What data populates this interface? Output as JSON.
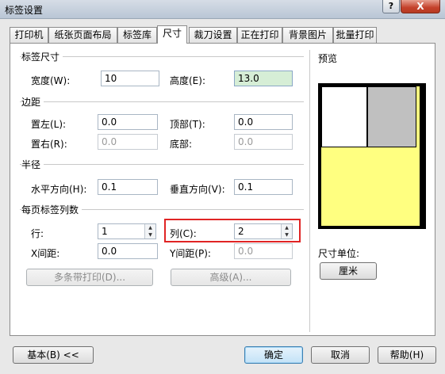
{
  "window": {
    "title": "标签设置",
    "help_label": "?",
    "close_label": "X"
  },
  "tabs": [
    "打印机",
    "纸张页面布局",
    "标签库",
    "尺寸",
    "裁刀设置",
    "正在打印",
    "背景图片",
    "批量打印"
  ],
  "label_size": {
    "title": "标签尺寸",
    "width_label": "宽度(W):",
    "width_value": "10",
    "height_label": "高度(E):",
    "height_value": "13.0"
  },
  "margins": {
    "title": "边距",
    "left_label": "置左(L):",
    "left_value": "0.0",
    "top_label": "顶部(T):",
    "top_value": "0.0",
    "right_label": "置右(R):",
    "right_value": "0.0",
    "bottom_label": "底部:",
    "bottom_value": "0.0"
  },
  "radius": {
    "title": "半径",
    "h_label": "水平方向(H):",
    "h_value": "0.1",
    "v_label": "垂直方向(V):",
    "v_value": "0.1"
  },
  "layout": {
    "title": "每页标签列数",
    "rows_label": "行:",
    "rows_value": "1",
    "cols_label": "列(C):",
    "cols_value": "2",
    "xgap_label": "X间距:",
    "xgap_value": "0.0",
    "ygap_label": "Y间距(P):",
    "ygap_value": "0.0"
  },
  "buttons": {
    "multi_print": "多条带打印(D)...",
    "advanced": "高级(A)...",
    "basic": "基本(B) <<",
    "ok": "确定",
    "cancel": "取消",
    "help": "帮助(H)"
  },
  "preview": {
    "title": "预览",
    "unit_label": "尺寸单位:",
    "unit_value": "厘米"
  },
  "colors": {
    "preview_label_fill": "#ffff80",
    "highlight_box": "#e02424"
  }
}
